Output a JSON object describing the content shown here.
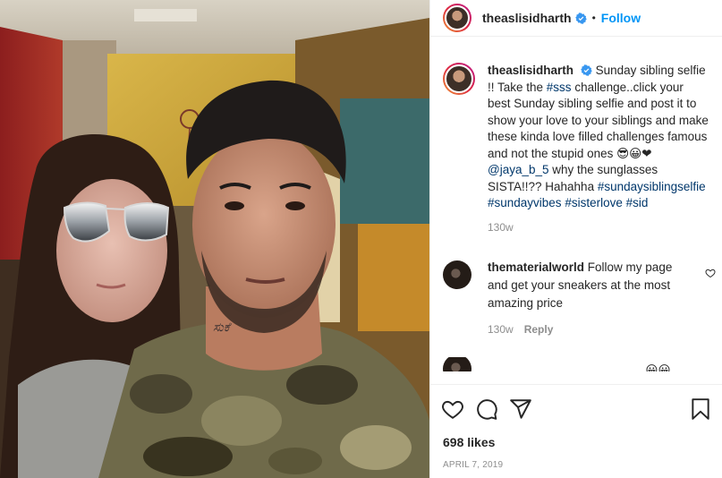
{
  "post": {
    "username": "theaslisidharth",
    "follow_label": "Follow",
    "separator": "•"
  },
  "caption": {
    "username": "theaslisidharth",
    "text_1": "Sunday sibling selfie !! Take the ",
    "tag_sss": "#sss",
    "text_2": " challenge..click your best Sunday sibling selfie and post it to show your love to your siblings and make these kinda love filled challenges famous and not the stupid ones 😎😀❤",
    "mention": "@jaya_b_5",
    "text_3": " why the sunglasses SISTA!!?? Hahahha",
    "tag_1": "#sundaysiblingselfie",
    "tag_2": "#sundayvibes",
    "tag_3": "#sisterlove",
    "tag_4": "#sid",
    "time": "130w"
  },
  "comment": {
    "username": "thematerialworld",
    "text": "Follow my page and get your sneakers at the most amazing price",
    "time": "130w",
    "reply_label": "Reply"
  },
  "partial_comment": {
    "text": "________ ____ _ ___ _____ 😀😀"
  },
  "footer": {
    "likes": "698 likes",
    "date": "April 7, 2019"
  },
  "colors": {
    "link": "#00376b",
    "follow": "#0095f6",
    "verified": "#3897f0",
    "heart": "#e0245e"
  },
  "icons": [
    "heart-icon",
    "comment-icon",
    "share-icon",
    "bookmark-icon",
    "verified-badge-icon",
    "heart-small-icon"
  ]
}
